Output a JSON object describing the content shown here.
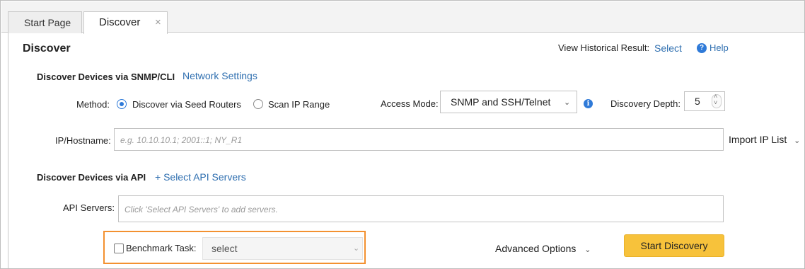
{
  "tabs": [
    {
      "label": "Start Page"
    },
    {
      "label": "Discover",
      "close": "×"
    }
  ],
  "page": {
    "title": "Discover",
    "historical_label": "View Historical Result:",
    "historical_link": "Select",
    "help_label": "Help"
  },
  "snmp_section": {
    "title": "Discover Devices via SNMP/CLI",
    "settings_link": "Network Settings",
    "method_label": "Method:",
    "method_options": [
      "Discover via Seed Routers",
      "Scan IP Range"
    ],
    "method_selected": "Discover via Seed Routers",
    "access_mode_label": "Access Mode:",
    "access_mode_value": "SNMP and SSH/Telnet",
    "depth_label": "Discovery Depth:",
    "depth_value": "5",
    "ip_label": "IP/Hostname:",
    "ip_placeholder": "e.g. 10.10.10.1; 2001::1; NY_R1",
    "import_label": "Import IP List"
  },
  "api_section": {
    "title": "Discover Devices via API",
    "select_link": "+ Select API Servers",
    "servers_label": "API Servers:",
    "servers_placeholder": "Click 'Select API Servers' to add servers."
  },
  "footer": {
    "benchmark_label": "Benchmark Task:",
    "benchmark_checked": false,
    "benchmark_value": "select",
    "advanced_label": "Advanced Options",
    "start_button": "Start Discovery"
  },
  "colors": {
    "accent_link": "#2f6fb0",
    "start_button": "#f7c23b",
    "highlight_border": "#f39130",
    "radio_selected": "#2f7ad8"
  },
  "icons": [
    "close-icon",
    "help-icon",
    "info-icon",
    "chevron-down-icon",
    "spinner-icon",
    "checkbox-icon",
    "radio-icon"
  ]
}
